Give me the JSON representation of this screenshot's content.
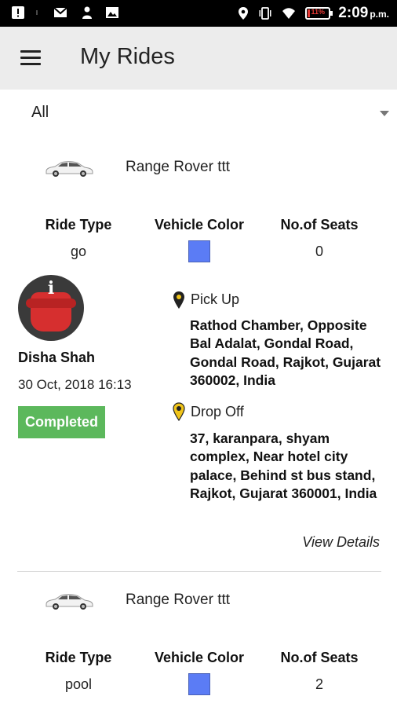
{
  "status_bar": {
    "time": "2:09",
    "ampm": "p.m.",
    "battery_text": "11%",
    "battery_level": 0.11
  },
  "toolbar": {
    "menu_icon": "menu-icon",
    "title": "My Rides"
  },
  "filter": {
    "selected": "All"
  },
  "labels": {
    "ride_type": "Ride Type",
    "vehicle_color": "Vehicle Color",
    "seats": "No.of Seats",
    "pick_up": "Pick Up",
    "drop_off": "Drop Off",
    "view_details": "View Details"
  },
  "rides": [
    {
      "vehicle_name": "Range Rover ttt",
      "ride_type": "go",
      "vehicle_color": "#5b7cf5",
      "seats": "0",
      "rider_name": "Disha Shah",
      "date": "30 Oct, 2018 16:13",
      "status": "Completed",
      "status_color": "#5cb85c",
      "pickup": "Rathod Chamber, Opposite Bal Adalat, Gondal Road, Gondal Road, Rajkot, Gujarat 360002, India",
      "dropoff": "37, karanpara, shyam complex, Near hotel city palace, Behind st bus stand, Rajkot, Gujarat 360001, India"
    },
    {
      "vehicle_name": "Range Rover ttt",
      "ride_type": "pool",
      "vehicle_color": "#5b7cf5",
      "seats": "2"
    }
  ]
}
